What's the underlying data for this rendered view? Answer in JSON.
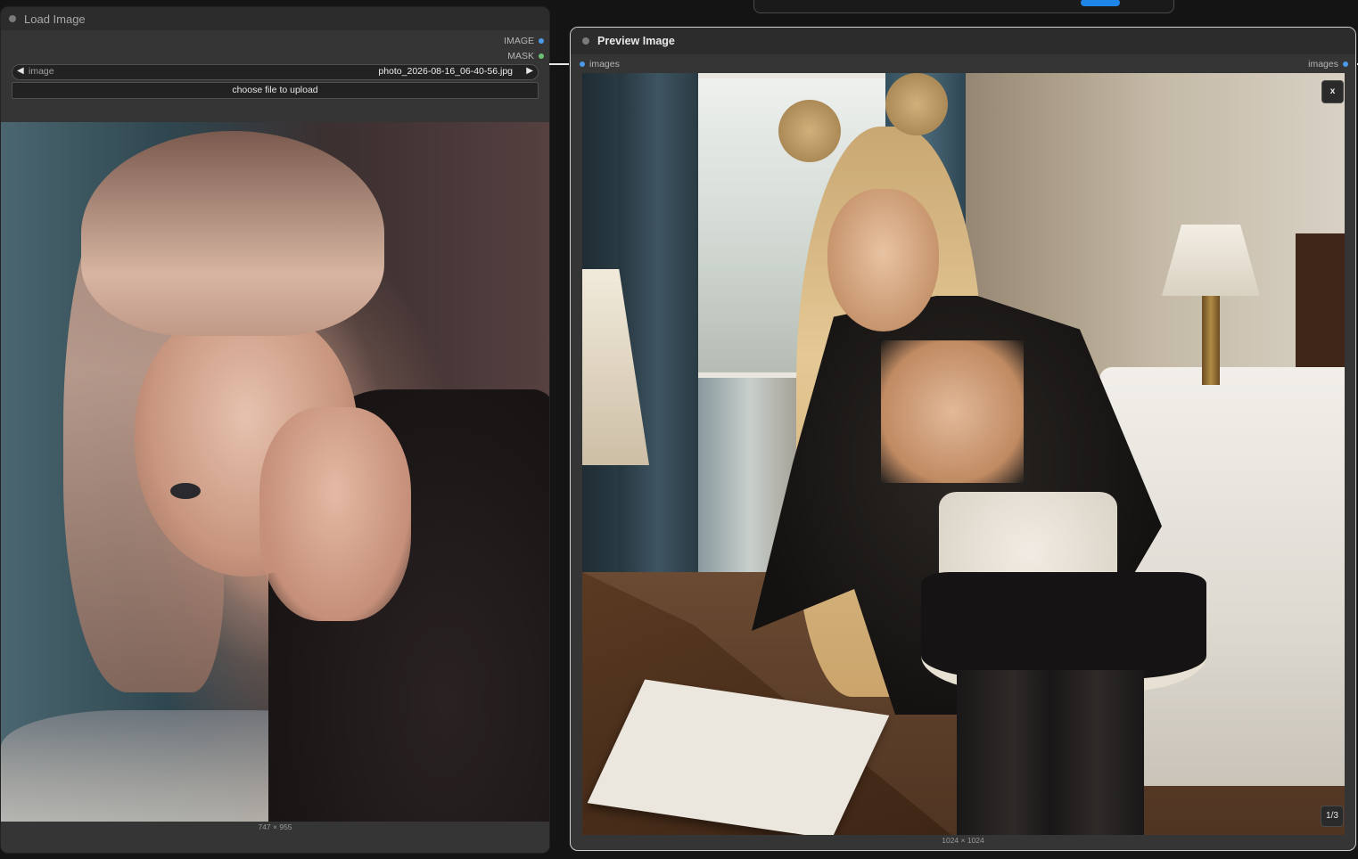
{
  "load_image_node": {
    "title": "Load Image",
    "outputs": [
      {
        "label": "IMAGE",
        "color": "#4c9be8"
      },
      {
        "label": "MASK",
        "color": "#6fbf73"
      }
    ],
    "image_widget": {
      "label": "image",
      "value": "photo_2026-08-16_06-40-56.jpg"
    },
    "upload_button_label": "choose file to upload",
    "preview_dimensions": "747 × 955"
  },
  "preview_image_node": {
    "title": "Preview Image",
    "input_label": "images",
    "output_label": "images",
    "slot_color": "#4c9be8",
    "close_button_label": "x",
    "page_indicator": "1/3",
    "preview_dimensions": "1024 × 1024"
  },
  "colors": {
    "canvas_bg": "#141414",
    "node_bg": "#353535",
    "node_header_bg": "#2c2c2c",
    "accent_blue": "#1e86e8",
    "link_wire": "#e8e8e8"
  }
}
